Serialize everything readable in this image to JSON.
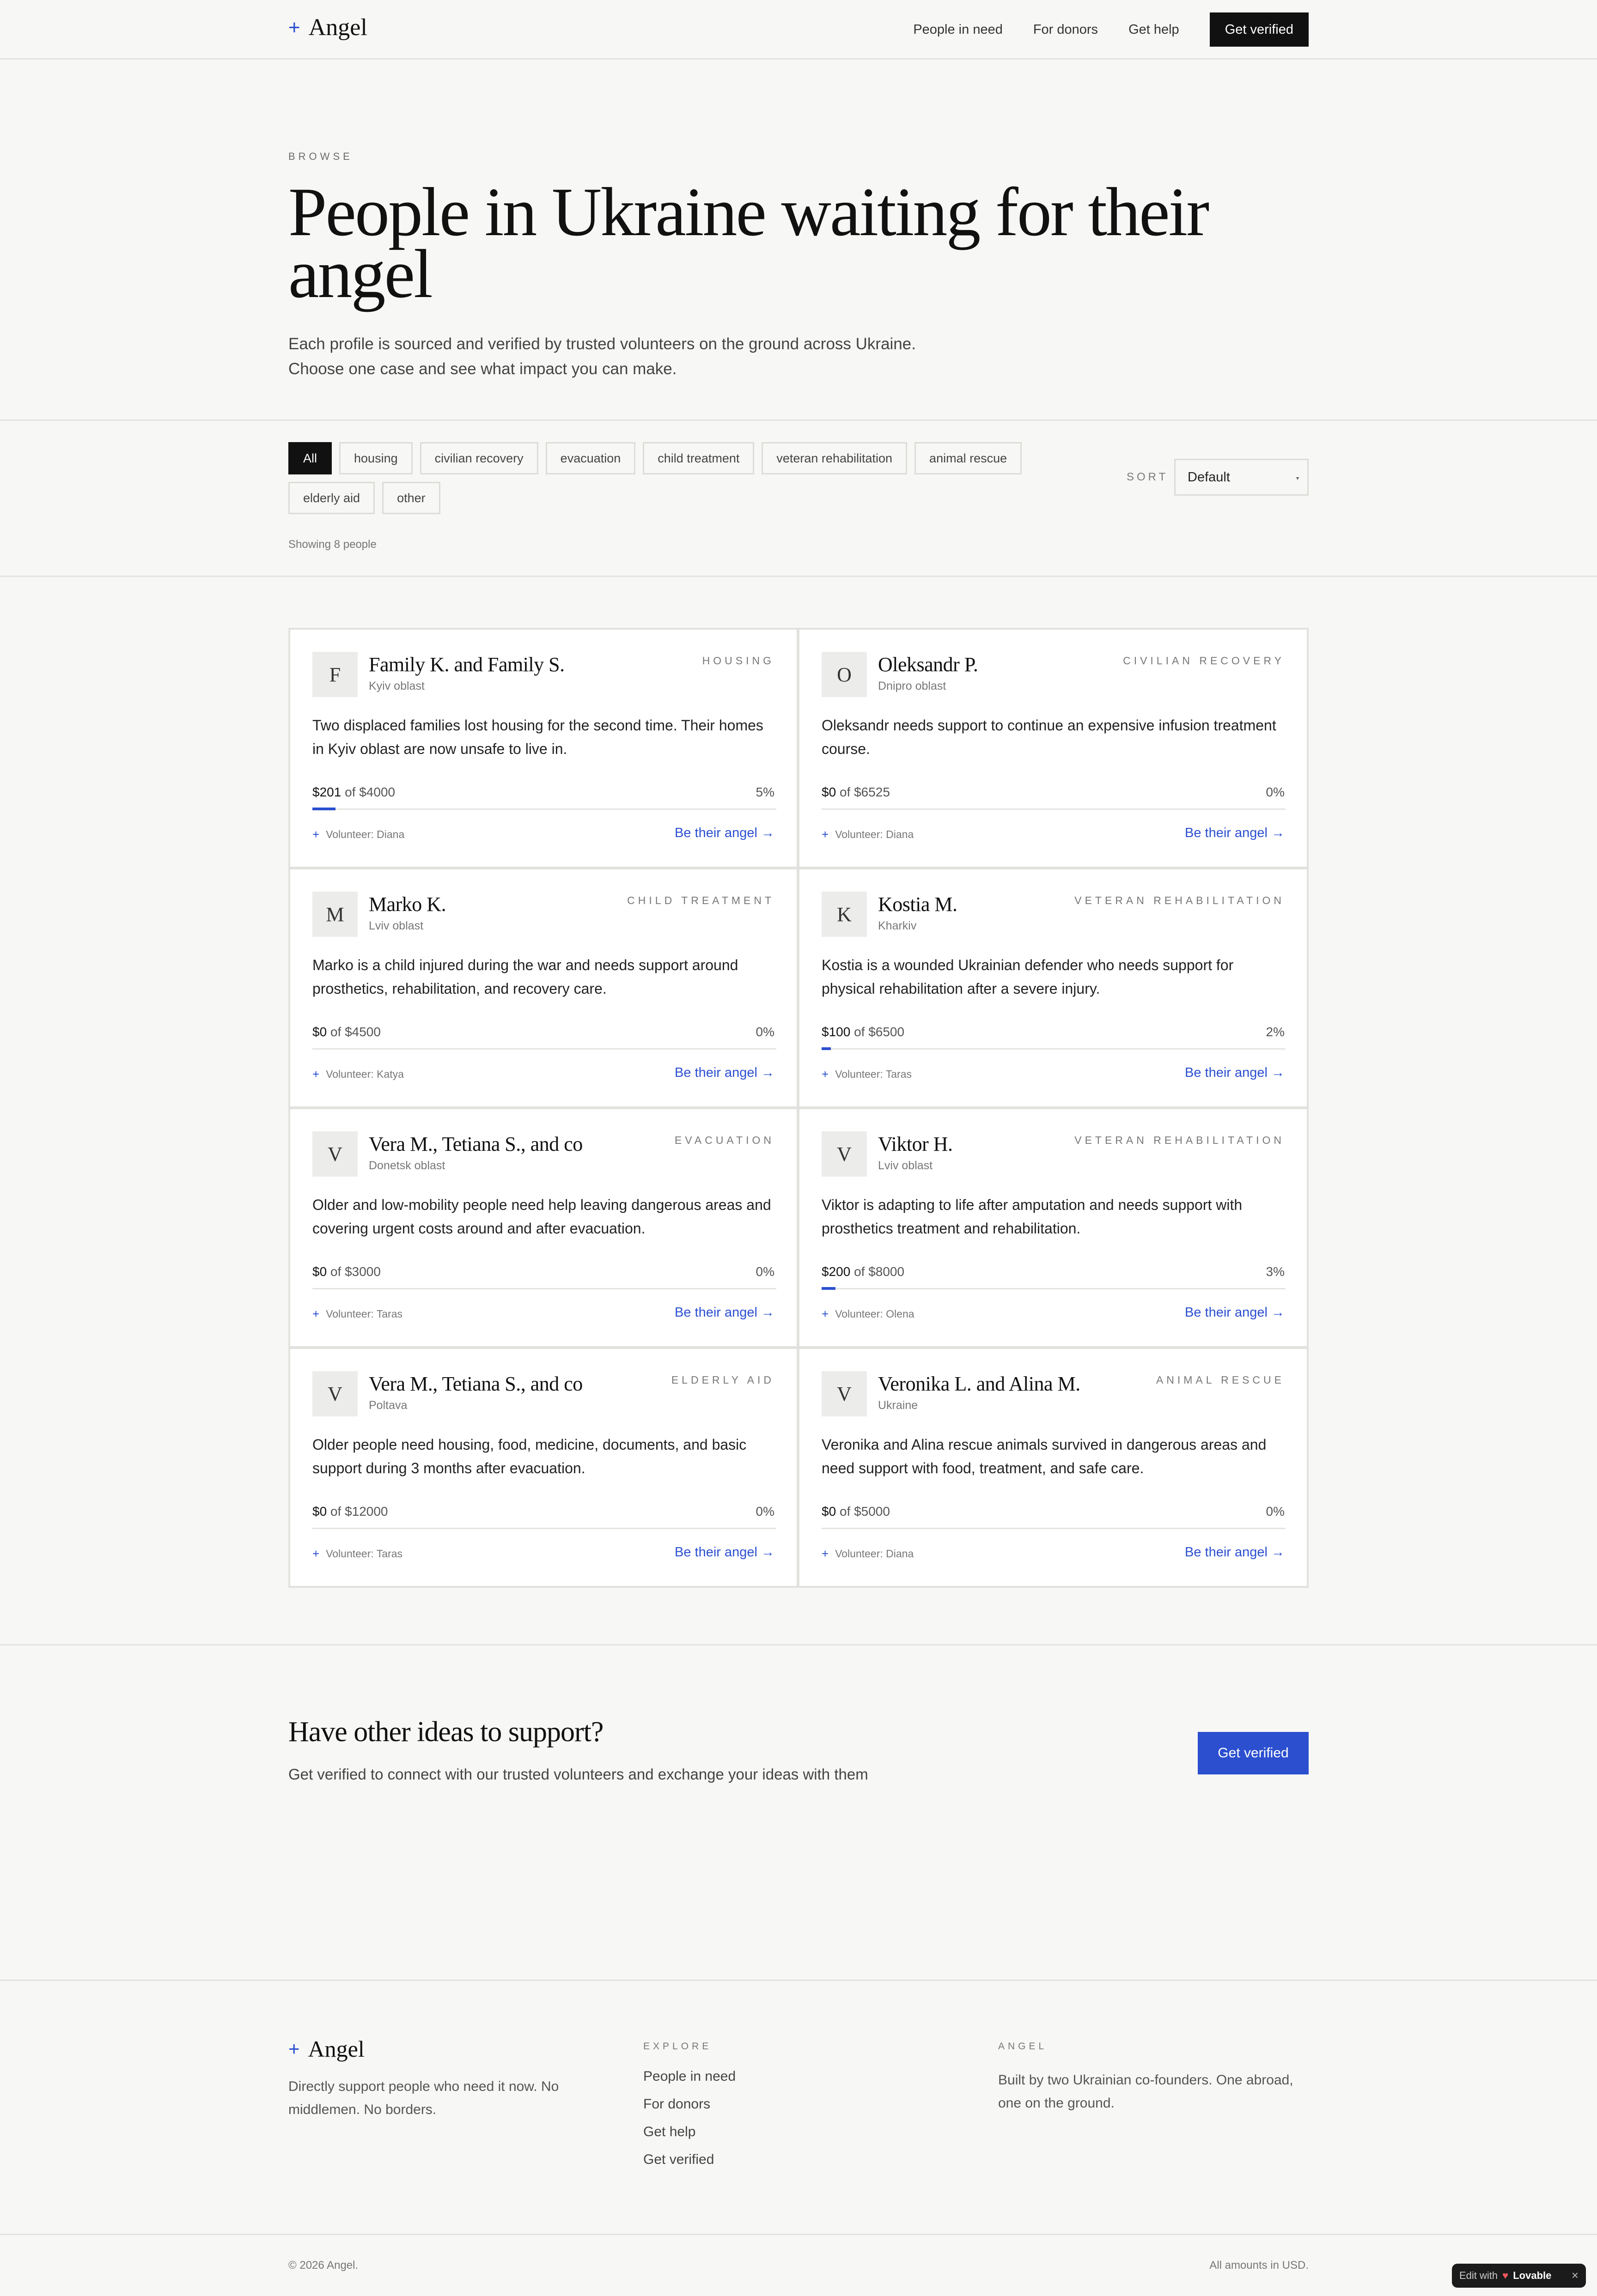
{
  "header": {
    "logo_text": "Angel",
    "nav": [
      "People in need",
      "For donors",
      "Get help"
    ],
    "cta": "Get verified"
  },
  "hero": {
    "eyebrow": "BROWSE",
    "title": "People in Ukraine waiting for their angel",
    "subtitle_line1": "Each profile is sourced and verified by trusted volunteers on the ground across Ukraine.",
    "subtitle_line2": "Choose one case and see what impact you can make."
  },
  "filters": {
    "chips": [
      "All",
      "housing",
      "civilian recovery",
      "evacuation",
      "child treatment",
      "veteran rehabilitation",
      "animal rescue",
      "elderly aid",
      "other"
    ],
    "active": "All",
    "sort_label": "SORT",
    "sort_value": "Default",
    "showing": "Showing 8 people"
  },
  "cards": [
    {
      "initial": "F",
      "name": "Family K. and Family S.",
      "region": "Kyiv oblast",
      "category": "Housing",
      "desc": "Two displaced families lost housing for the second time. Their homes in Kyiv oblast are now unsafe to live in.",
      "raised": "$201",
      "goal": "of $4000",
      "pct": "5%",
      "progress": 0.05,
      "volunteer": "Volunteer: Diana",
      "link": "Be their angel →"
    },
    {
      "initial": "O",
      "name": "Oleksandr P.",
      "region": "Dnipro oblast",
      "category": "Civilian recovery",
      "desc": "Oleksandr needs support to continue an expensive infusion treatment course.",
      "raised": "$0",
      "goal": "of $6525",
      "pct": "0%",
      "progress": 0,
      "volunteer": "Volunteer: Diana",
      "link": "Be their angel →"
    },
    {
      "initial": "M",
      "name": "Marko K.",
      "region": "Lviv oblast",
      "category": "Child treatment",
      "desc": "Marko is a child injured during the war and needs support around prosthetics, rehabilitation, and recovery care.",
      "raised": "$0",
      "goal": "of $4500",
      "pct": "0%",
      "progress": 0,
      "volunteer": "Volunteer: Katya",
      "link": "Be their angel →"
    },
    {
      "initial": "K",
      "name": "Kostia M.",
      "region": "Kharkiv",
      "category": "Veteran rehabilitation",
      "desc": "Kostia is a wounded Ukrainian defender who needs support for physical rehabilitation after a severe injury.",
      "raised": "$100",
      "goal": "of $6500",
      "pct": "2%",
      "progress": 0.02,
      "volunteer": "Volunteer: Taras",
      "link": "Be their angel →"
    },
    {
      "initial": "V",
      "name": "Vera M., Tetiana S., and co",
      "region": "Donetsk oblast",
      "category": "Evacuation",
      "desc": "Older and low-mobility people need help leaving dangerous areas and covering urgent costs around and after evacuation.",
      "raised": "$0",
      "goal": "of $3000",
      "pct": "0%",
      "progress": 0,
      "volunteer": "Volunteer: Taras",
      "link": "Be their angel →"
    },
    {
      "initial": "V",
      "name": "Viktor H.",
      "region": "Lviv oblast",
      "category": "Veteran rehabilitation",
      "desc": "Viktor is adapting to life after amputation and needs support with prosthetics treatment and rehabilitation.",
      "raised": "$200",
      "goal": "of $8000",
      "pct": "3%",
      "progress": 0.03,
      "volunteer": "Volunteer: Olena",
      "link": "Be their angel →"
    },
    {
      "initial": "V",
      "name": "Vera M., Tetiana S., and co",
      "region": "Poltava",
      "category": "Elderly aid",
      "desc": "Older people need housing, food, medicine, documents, and basic support during 3 months after evacuation.",
      "raised": "$0",
      "goal": "of $12000",
      "pct": "0%",
      "progress": 0,
      "volunteer": "Volunteer: Taras",
      "link": "Be their angel →"
    },
    {
      "initial": "V",
      "name": "Veronika L. and Alina M.",
      "region": "Ukraine",
      "category": "Animal rescue",
      "desc": "Veronika and Alina rescue animals survived in dangerous areas and need support with food, treatment, and safe care.",
      "raised": "$0",
      "goal": "of $5000",
      "pct": "0%",
      "progress": 0,
      "volunteer": "Volunteer: Diana",
      "link": "Be their angel →"
    }
  ],
  "cta": {
    "title": "Have other ideas to support?",
    "subtitle": "Get verified to connect with our trusted volunteers and exchange your ideas with them",
    "button": "Get verified"
  },
  "footer": {
    "logo_text": "Angel",
    "description": "Directly support people who need it now. No middlemen. No borders.",
    "explore_heading": "EXPLORE",
    "explore_links": [
      "People in need",
      "For donors",
      "Get help",
      "Get verified"
    ],
    "angel_heading": "ANGEL",
    "angel_text": "Built by two Ukrainian co-founders. One abroad, one on the ground.",
    "copyright": "© 2026 Angel.",
    "currency_note": "All amounts in USD."
  },
  "badge": {
    "prefix": "Edit with",
    "brand": "Lovable"
  },
  "colors": {
    "accent": "#2b4fcf",
    "dark": "#111111",
    "background": "#f7f7f5"
  }
}
